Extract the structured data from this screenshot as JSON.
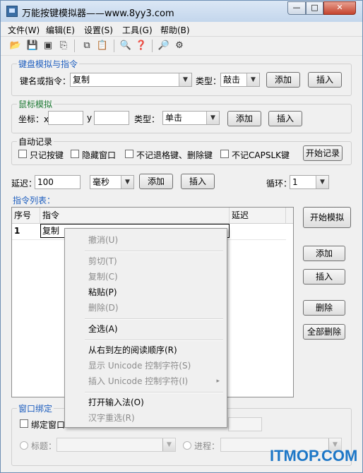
{
  "window": {
    "title": "万能按键模拟器——www.8yy3.com",
    "min_glyph": "—",
    "max_glyph": "□",
    "close_glyph": "✕"
  },
  "menu": [
    "文件(W)",
    "编辑(E)",
    "设置(S)",
    "工具(G)",
    "帮助(B)"
  ],
  "toolbar_icons": [
    "open-folder-icon",
    "save-icon",
    "save-as-icon",
    "export-icon",
    "copy-icon",
    "paste-icon",
    "print-preview-icon",
    "help-icon",
    "search-icon",
    "run-icon"
  ],
  "keyboard": {
    "legend": "键盘模拟与指令",
    "key_label": "键名或指令：",
    "key_value": "复制",
    "type_label": "类型：",
    "type_value": "敲击",
    "add": "添加",
    "insert": "插入"
  },
  "mouse": {
    "legend": "鼠标模拟",
    "coord_label": "坐标：x",
    "x_value": "",
    "y_label": "y",
    "y_value": "",
    "type_label": "类型：",
    "type_value": "单击",
    "add": "添加",
    "insert": "插入"
  },
  "autorecord": {
    "legend": "自动记录",
    "options": [
      "只记按键",
      "隐藏窗口",
      "不记退格键、删除键",
      "不记CAPSLK键"
    ],
    "start": "开始记录"
  },
  "delay": {
    "label": "延迟：",
    "value": "100",
    "unit": "毫秒",
    "add": "添加",
    "insert": "插入",
    "loop_label": "循环：",
    "loop_value": "1"
  },
  "commands": {
    "label": "指令列表：",
    "headers": [
      "序号",
      "指令",
      "延迟"
    ],
    "rows": [
      {
        "index": "1",
        "command": "复制",
        "delay": ""
      }
    ]
  },
  "side_buttons": {
    "start_sim": "开始模拟",
    "add": "添加",
    "insert": "插入",
    "delete": "删除",
    "delete_all": "全部删除"
  },
  "context_menu": {
    "undo": "撤消(U)",
    "cut": "剪切(T)",
    "copy": "复制(C)",
    "paste": "粘贴(P)",
    "delete": "删除(D)",
    "select_all": "全选(A)",
    "rtl": "从右到左的阅读顺序(R)",
    "show_unicode": "显示 Unicode 控制字符(S)",
    "insert_unicode": "插入 Unicode 控制字符(I)",
    "submenu_arrow": "▸",
    "open_ime": "打开输入法(O)",
    "reconversion": "汉字重选(R)"
  },
  "window_bind": {
    "legend": "窗口绑定",
    "bind_label": "绑定窗口",
    "title_label": "标题：",
    "process_label": "进程："
  },
  "watermark": "ITMOP.COM"
}
